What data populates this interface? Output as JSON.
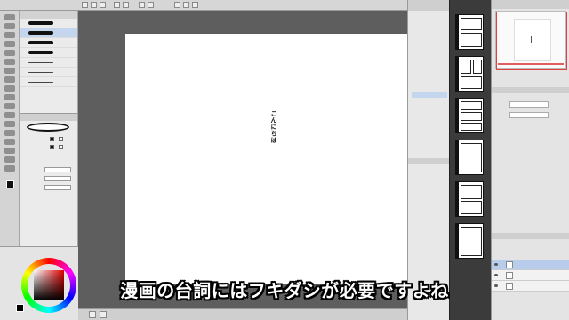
{
  "canvas": {
    "text": "こんにちは"
  },
  "caption": {
    "text": "漫画の台詞にはフキダシが必要ですよね"
  },
  "colors": {
    "canvas_bg": "#5e5e5e",
    "page": "#ffffff",
    "accent": "#c4d5ee",
    "caption_fill": "#ffffff",
    "caption_outline": "#000000"
  },
  "icons": [
    "magnifier-icon",
    "move-icon",
    "pen-icon",
    "eraser-icon",
    "fill-icon",
    "text-icon",
    "balloon-icon",
    "eye-icon",
    "gear-icon"
  ]
}
